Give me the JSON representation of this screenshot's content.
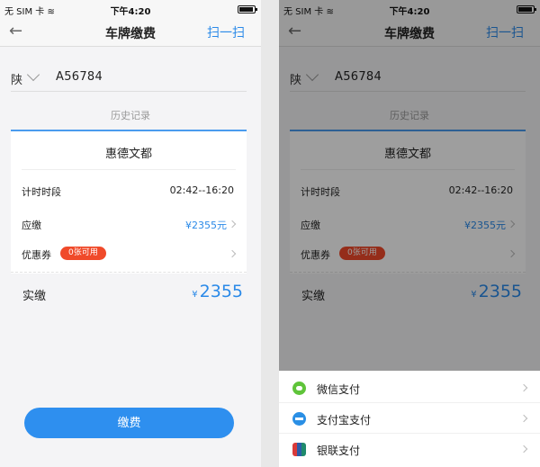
{
  "status": {
    "carrier": "无 SIM 卡",
    "time": "下午4:20"
  },
  "nav": {
    "back": "←",
    "title": "车牌缴费",
    "scan": "扫一扫"
  },
  "plate": {
    "province": "陕",
    "number": "A56784"
  },
  "history": "历史记录",
  "card": {
    "title": "惠德文都",
    "time_label": "计时时段",
    "time_value": "02:42--16:20",
    "due_label": "应缴",
    "due_value": "¥2355元",
    "coupon_label": "优惠券",
    "coupon_badge": "0张可用"
  },
  "payment": {
    "label": "实缴",
    "currency": "¥",
    "amount": "2355"
  },
  "pay_button": "缴费",
  "sheet": {
    "options": [
      {
        "label": "微信支付",
        "icon": "wechat-icon"
      },
      {
        "label": "支付宝支付",
        "icon": "alipay-icon"
      },
      {
        "label": "银联支付",
        "icon": "unionpay-icon"
      }
    ]
  },
  "colors": {
    "accent": "#2e8fef",
    "coupon": "#f04a2a"
  }
}
